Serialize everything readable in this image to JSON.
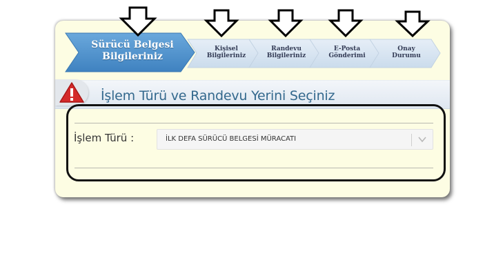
{
  "steps": [
    {
      "line1": "Sürücü Belgesi",
      "line2": "Bilgileriniz",
      "active": true
    },
    {
      "line1": "Kişisel",
      "line2": "Bilgileriniz",
      "active": false
    },
    {
      "line1": "Randevu",
      "line2": "Bilgileriniz",
      "active": false
    },
    {
      "line1": "E-Posta",
      "line2": "Gönderimi",
      "active": false
    },
    {
      "line1": "Onay",
      "line2": "Durumu",
      "active": false
    }
  ],
  "section": {
    "icon": "warning-icon",
    "title": "İşlem Türü ve Randevu Yerini Seçiniz"
  },
  "form": {
    "islem_turu_label": "İşlem Türü :",
    "islem_turu_value": "İLK DEFA SÜRÜCÜ BELGESİ MÜRACATI"
  },
  "colors": {
    "active_step": "#4a8fcb",
    "inactive_step": "#d6e3f0",
    "panel_bg": "#fdfde3",
    "title": "#33688d",
    "warning": "#d42a2a"
  }
}
